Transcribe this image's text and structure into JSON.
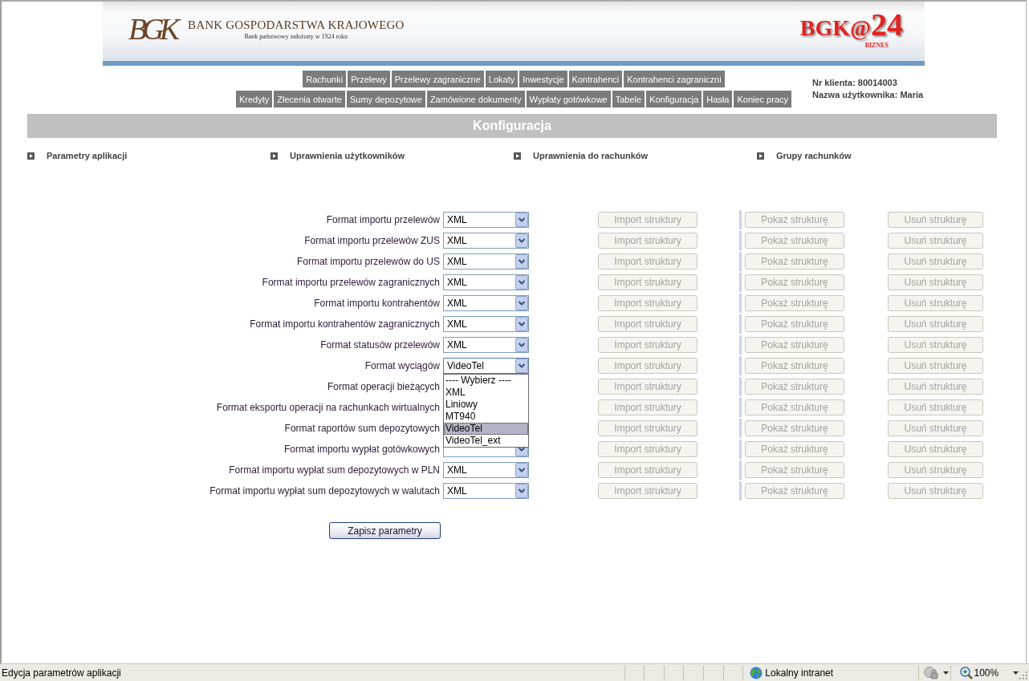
{
  "banner": {
    "monogram": "BGK",
    "bank_name": "BANK GOSPODARSTWA KRAJOWEGO",
    "bank_subtitle": "Bank państwowy założony w 1924 roku",
    "service_logo": "BGK@",
    "service_logo_number": "24",
    "service_tagline": "BIZNES"
  },
  "menu_rows": [
    [
      "Rachunki",
      "Przelewy",
      "Przelewy zagraniczne",
      "Lokaty",
      "Inwestycje",
      "Kontrahenci",
      "Kontrahenci zagraniczni"
    ],
    [
      "Kredyty",
      "Zlecenia otwarte",
      "Sumy depozytowe",
      "Zamówione dokumenty",
      "Wypłaty gotówkowe",
      "Tabele",
      "Konfiguracja",
      "Hasła",
      "Koniec pracy"
    ]
  ],
  "client_info": {
    "client_number": "Nr klienta: 80014003",
    "user_name": "Nazwa użytkownika: Maria"
  },
  "page_title": "Konfiguracja",
  "sections": [
    "Parametry aplikacji",
    "Uprawnienia użytkowników",
    "Uprawnienia do rachunków",
    "Grupy rachunków"
  ],
  "formats": [
    {
      "label": "Format importu przelewów",
      "kind": "select",
      "value": "XML",
      "expanded": false,
      "buttons": [
        {
          "label": "Import struktury",
          "disabled": true
        },
        {
          "label": "Pokaż strukturę",
          "disabled": true
        },
        {
          "label": "Usuń strukturę",
          "disabled": true
        }
      ]
    },
    {
      "label": "Format importu przelewów ZUS",
      "kind": "select",
      "value": "XML",
      "expanded": false,
      "buttons": [
        {
          "label": "Import struktury",
          "disabled": true
        },
        {
          "label": "Pokaż strukturę",
          "disabled": true
        },
        {
          "label": "Usuń strukturę",
          "disabled": true
        }
      ]
    },
    {
      "label": "Format importu przelewów do US",
      "kind": "select",
      "value": "XML",
      "expanded": false,
      "buttons": [
        {
          "label": "Import struktury",
          "disabled": true
        },
        {
          "label": "Pokaż strukturę",
          "disabled": true
        },
        {
          "label": "Usuń strukturę",
          "disabled": true
        }
      ]
    },
    {
      "label": "Format importu przelewów zagranicznych",
      "kind": "select",
      "value": "XML",
      "expanded": false,
      "buttons": [
        {
          "label": "Import struktury",
          "disabled": true
        },
        {
          "label": "Pokaż strukturę",
          "disabled": true
        },
        {
          "label": "Usuń strukturę",
          "disabled": true
        }
      ]
    },
    {
      "label": "Format importu kontrahentów",
      "kind": "select",
      "value": "XML",
      "expanded": false,
      "buttons": [
        {
          "label": "Import struktury",
          "disabled": true
        },
        {
          "label": "Pokaż strukturę",
          "disabled": true
        },
        {
          "label": "Usuń strukturę",
          "disabled": true
        }
      ]
    },
    {
      "label": "Format importu kontrahentów zagranicznych",
      "kind": "select",
      "value": "XML",
      "expanded": false,
      "buttons": [
        {
          "label": "Import struktury",
          "disabled": true
        },
        {
          "label": "Pokaż strukturę",
          "disabled": true
        },
        {
          "label": "Usuń strukturę",
          "disabled": true
        }
      ]
    },
    {
      "label": "Format statusów przelewów",
      "kind": "select",
      "value": "XML",
      "expanded": false,
      "buttons": [
        {
          "label": "Import struktury",
          "disabled": true
        },
        {
          "label": "Pokaż strukturę",
          "disabled": true
        },
        {
          "label": "Usuń strukturę",
          "disabled": true
        }
      ]
    },
    {
      "label": "Format wyciągów",
      "kind": "select",
      "value": "VideoTel",
      "expanded": true,
      "options": [
        {
          "label": "---- Wybierz ----",
          "selected": false
        },
        {
          "label": "XML",
          "selected": false
        },
        {
          "label": "Liniowy",
          "selected": false
        },
        {
          "label": "MT940",
          "selected": false
        },
        {
          "label": "VideoTel",
          "selected": true
        },
        {
          "label": "VideoTel_ext",
          "selected": false
        }
      ],
      "buttons": [
        {
          "label": "Import struktury",
          "disabled": true
        },
        {
          "label": "Pokaż strukturę",
          "disabled": true
        },
        {
          "label": "Usuń strukturę",
          "disabled": true
        }
      ]
    },
    {
      "label": "Format operacji bieżących",
      "kind": "covered",
      "buttons": [
        {
          "label": "Import struktury",
          "disabled": true
        },
        {
          "label": "Pokaż strukturę",
          "disabled": true
        },
        {
          "label": "Usuń strukturę",
          "disabled": true
        }
      ]
    },
    {
      "label": "Format eksportu operacji na rachunkach wirtualnych",
      "kind": "covered",
      "buttons": [
        {
          "label": "Import struktury",
          "disabled": true
        },
        {
          "label": "Pokaż strukturę",
          "disabled": true
        },
        {
          "label": "Usuń strukturę",
          "disabled": true
        }
      ]
    },
    {
      "label": "Format raportów sum depozytowych",
      "kind": "covered",
      "buttons": [
        {
          "label": "Import struktury",
          "disabled": true
        },
        {
          "label": "Pokaż strukturę",
          "disabled": true
        },
        {
          "label": "Usuń strukturę",
          "disabled": true
        }
      ]
    },
    {
      "label": "Format importu wypłat gotówkowych",
      "kind": "partly_covered",
      "expanded": false,
      "buttons": [
        {
          "label": "Import struktury",
          "disabled": true
        },
        {
          "label": "Pokaż strukturę",
          "disabled": true
        },
        {
          "label": "Usuń strukturę",
          "disabled": true
        }
      ]
    },
    {
      "label": "Format importu wypłat sum depozytowych w PLN",
      "kind": "select",
      "value": "XML",
      "expanded": false,
      "buttons": [
        {
          "label": "Import struktury",
          "disabled": true
        },
        {
          "label": "Pokaż strukturę",
          "disabled": true
        },
        {
          "label": "Usuń strukturę",
          "disabled": true
        }
      ]
    },
    {
      "label": "Format importu wypłat sum depozytowych w walutach",
      "kind": "select",
      "value": "XML",
      "expanded": false,
      "buttons": [
        {
          "label": "Import struktury",
          "disabled": true
        },
        {
          "label": "Pokaż strukturę",
          "disabled": true
        },
        {
          "label": "Usuń strukturę",
          "disabled": true
        }
      ]
    }
  ],
  "save_button": "Zapisz parametry",
  "status_bar": {
    "text": "Edycja parametrów aplikacji",
    "zone": "Lokalny intranet",
    "zoom": "100%"
  }
}
